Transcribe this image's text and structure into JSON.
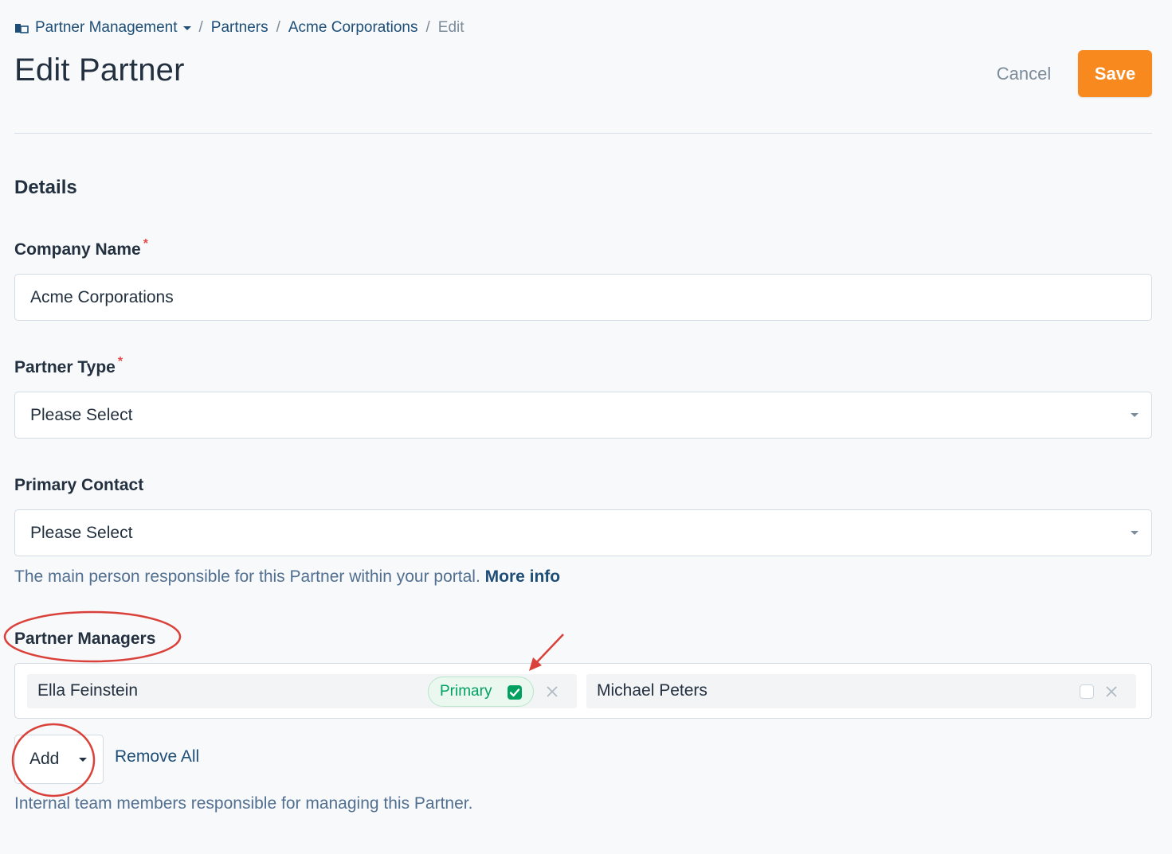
{
  "breadcrumb": {
    "items": [
      "Partner Management",
      "Partners",
      "Acme Corporations"
    ],
    "current": "Edit",
    "separator": "/"
  },
  "page": {
    "title": "Edit Partner"
  },
  "actions": {
    "cancel_label": "Cancel",
    "save_label": "Save"
  },
  "section": {
    "title": "Details"
  },
  "fields": {
    "company_name": {
      "label": "Company Name",
      "required_mark": "*",
      "value": "Acme Corporations"
    },
    "partner_type": {
      "label": "Partner Type",
      "required_mark": "*",
      "value": "Please Select"
    },
    "primary_contact": {
      "label": "Primary Contact",
      "value": "Please Select",
      "help_text": "The main person responsible for this Partner within your portal.",
      "help_link": "More info"
    },
    "partner_managers": {
      "label": "Partner Managers",
      "managers": [
        {
          "name": "Ella Feinstein",
          "badge": "Primary",
          "primary": true
        },
        {
          "name": "Michael Peters",
          "primary": false
        }
      ],
      "add_label": "Add",
      "remove_all_label": "Remove All",
      "help_text": "Internal team members responsible for managing this Partner."
    }
  },
  "colors": {
    "accent": "#f8891f",
    "link": "#1d4e77",
    "primary_badge": "#00a060",
    "annotation": "#d9413a"
  },
  "icons": [
    "building-icon",
    "chevron-down-icon",
    "checkbox-checked-icon",
    "close-icon",
    "checkbox-empty-icon"
  ]
}
